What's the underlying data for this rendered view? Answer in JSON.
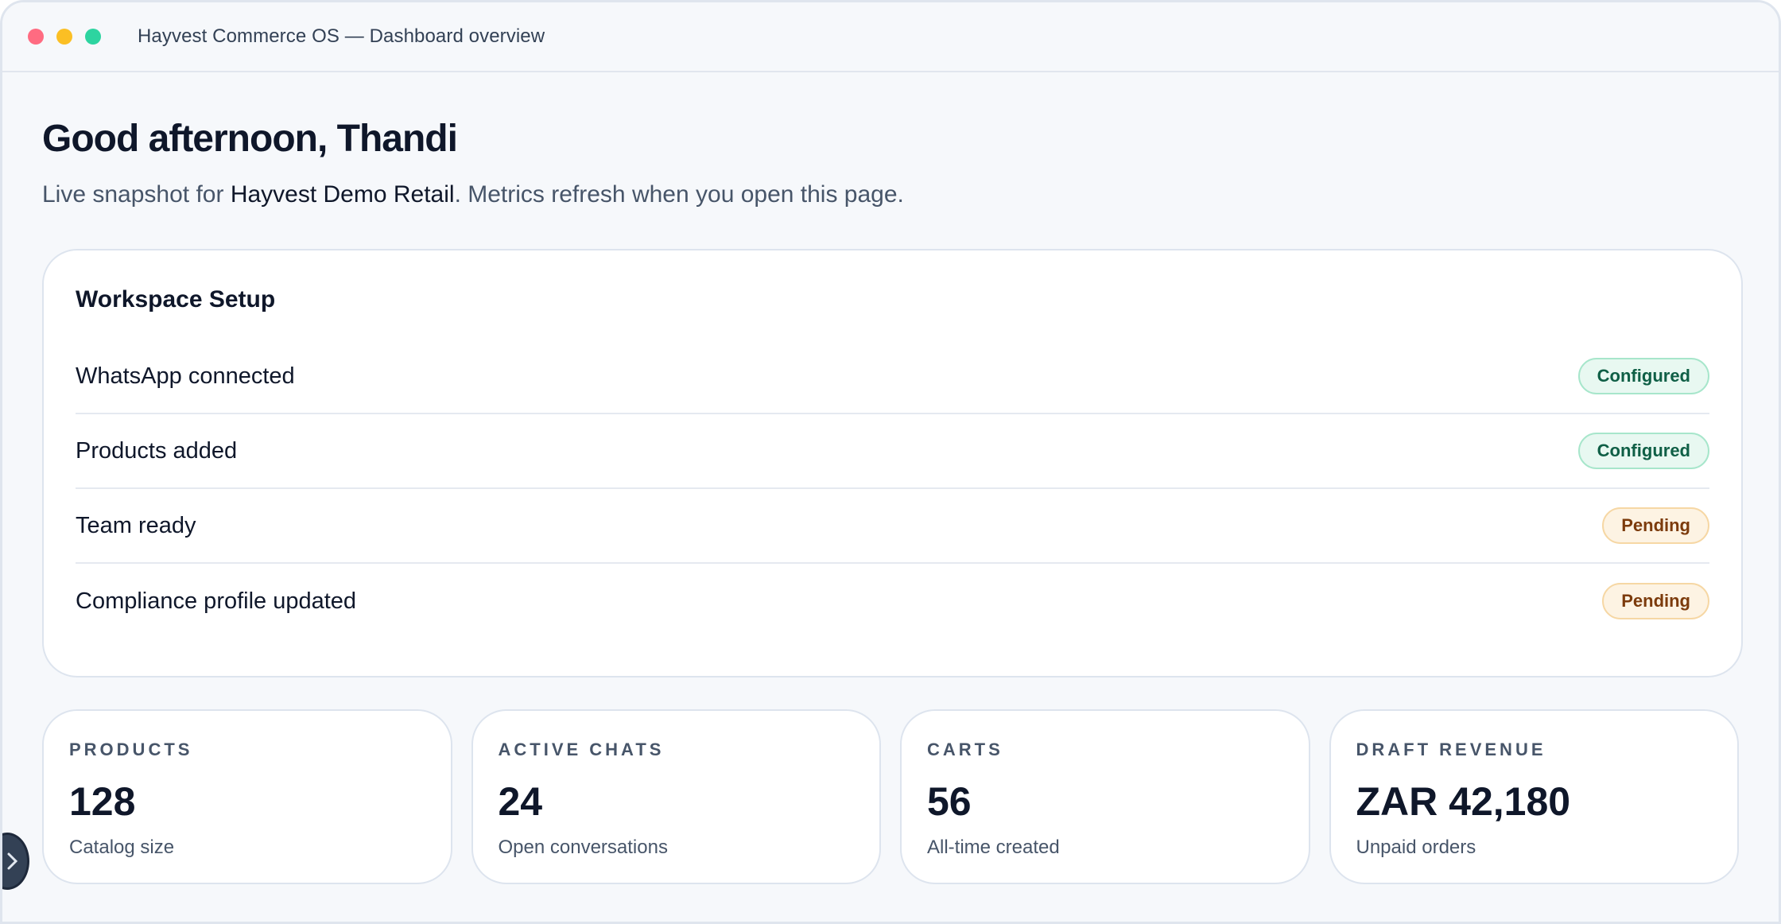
{
  "window": {
    "title": "Hayvest Commerce OS — Dashboard overview"
  },
  "header": {
    "greeting": "Good afternoon, Thandi",
    "subtitle_prefix": "Live snapshot for ",
    "store_name": "Hayvest Demo Retail",
    "subtitle_suffix": ". Metrics refresh when you open this page."
  },
  "setup": {
    "title": "Workspace Setup",
    "items": [
      {
        "label": "WhatsApp connected",
        "status": "Configured"
      },
      {
        "label": "Products added",
        "status": "Configured"
      },
      {
        "label": "Team ready",
        "status": "Pending"
      },
      {
        "label": "Compliance profile updated",
        "status": "Pending"
      }
    ]
  },
  "stats": [
    {
      "label": "PRODUCTS",
      "value": "128",
      "caption": "Catalog size"
    },
    {
      "label": "ACTIVE CHATS",
      "value": "24",
      "caption": "Open conversations"
    },
    {
      "label": "CARTS",
      "value": "56",
      "caption": "All-time created"
    },
    {
      "label": "DRAFT REVENUE",
      "value": "ZAR 42,180",
      "caption": "Unpaid orders"
    }
  ],
  "colors": {
    "configured": "#0f5f46",
    "pending": "#7c3b0c",
    "traffic_red": "#ff6b81",
    "traffic_yellow": "#fbbf24",
    "traffic_green": "#2dd4a0"
  },
  "icons": {
    "fab": "collapse-icon"
  }
}
